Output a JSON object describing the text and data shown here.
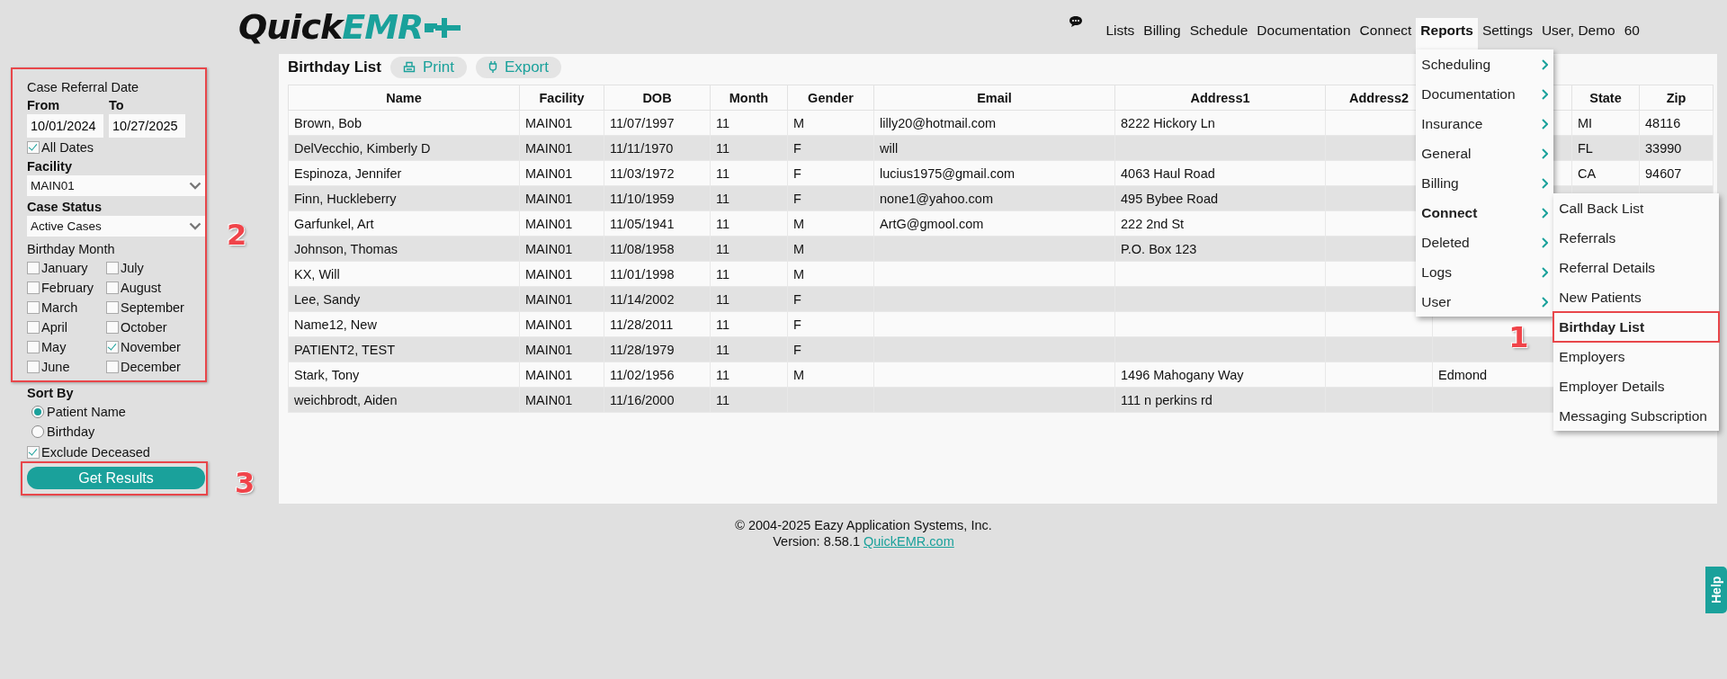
{
  "header": {
    "logo": {
      "part_1": "Quick",
      "part_2": "EMR"
    },
    "nav": [
      {
        "label": "Lists",
        "selected": false
      },
      {
        "label": "Billing",
        "selected": false
      },
      {
        "label": "Schedule",
        "selected": false
      },
      {
        "label": "Documentation",
        "selected": false
      },
      {
        "label": "Connect",
        "selected": false
      },
      {
        "label": "Reports",
        "selected": true
      },
      {
        "label": "Settings",
        "selected": false
      },
      {
        "label": "User, Demo",
        "selected": false
      },
      {
        "label": "60",
        "selected": false
      }
    ]
  },
  "reports_menu": {
    "items": [
      {
        "label": "Scheduling",
        "expanded": false
      },
      {
        "label": "Documentation",
        "expanded": false
      },
      {
        "label": "Insurance",
        "expanded": false
      },
      {
        "label": "General",
        "expanded": false
      },
      {
        "label": "Billing",
        "expanded": false
      },
      {
        "label": "Connect",
        "expanded": true
      },
      {
        "label": "Deleted",
        "expanded": false
      },
      {
        "label": "Logs",
        "expanded": false
      },
      {
        "label": "User",
        "expanded": false
      }
    ],
    "submenu": {
      "items": [
        {
          "label": "Call Back List",
          "selected": false
        },
        {
          "label": "Referrals",
          "selected": false
        },
        {
          "label": "Referral Details",
          "selected": false
        },
        {
          "label": "New Patients",
          "selected": false
        },
        {
          "label": "Birthday List",
          "selected": true,
          "callout": "1"
        },
        {
          "label": "Employers",
          "selected": false
        },
        {
          "label": "Employer Details",
          "selected": false
        },
        {
          "label": "Messaging Subscription",
          "selected": false
        }
      ]
    }
  },
  "filters": {
    "callout": "2",
    "title": "Case Referral Date",
    "from": {
      "label": "From",
      "value": "10/01/2024"
    },
    "to": {
      "label": "To",
      "value": "10/27/2025"
    },
    "all_dates": {
      "label": "All Dates",
      "checked": true
    },
    "facility": {
      "label": "Facility",
      "value": "MAIN01"
    },
    "case_status": {
      "label": "Case Status",
      "value": "Active Cases"
    },
    "birthday_month": {
      "label": "Birthday Month",
      "months": [
        {
          "label": "January",
          "checked": false
        },
        {
          "label": "February",
          "checked": false
        },
        {
          "label": "March",
          "checked": false
        },
        {
          "label": "April",
          "checked": false
        },
        {
          "label": "May",
          "checked": false
        },
        {
          "label": "June",
          "checked": false
        },
        {
          "label": "July",
          "checked": false
        },
        {
          "label": "August",
          "checked": false
        },
        {
          "label": "September",
          "checked": false
        },
        {
          "label": "October",
          "checked": false
        },
        {
          "label": "November",
          "checked": true
        },
        {
          "label": "December",
          "checked": false
        }
      ]
    }
  },
  "sort_by": {
    "label": "Sort By",
    "options": [
      {
        "label": "Patient Name",
        "selected": true
      },
      {
        "label": "Birthday",
        "selected": false
      }
    ]
  },
  "exclude_deceased": {
    "label": "Exclude Deceased",
    "checked": true
  },
  "get_results": {
    "label": "Get Results",
    "callout": "3"
  },
  "report": {
    "title": "Birthday List",
    "actions": [
      {
        "label": "Print",
        "kind": "print"
      },
      {
        "label": "Export",
        "kind": "export"
      }
    ],
    "table": {
      "columns": [
        "Name",
        "Facility",
        "DOB",
        "Month",
        "Gender",
        "Email",
        "Address1",
        "Address2",
        null,
        "State",
        "Zip"
      ],
      "rows": [
        [
          "Brown, Bob",
          "MAIN01",
          "11/07/1997",
          "11",
          "M",
          "lilly20@hotmail.com",
          "8222 Hickory Ln",
          null,
          null,
          "MI",
          "48116"
        ],
        [
          "DelVecchio, Kimberly D",
          "MAIN01",
          "11/11/1970",
          "11",
          "F",
          "will",
          null,
          null,
          null,
          "FL",
          "33990"
        ],
        [
          "Espinoza, Jennifer",
          "MAIN01",
          "11/03/1972",
          "11",
          "F",
          "lucius1975@gmail.com",
          "4063 Haul Road",
          null,
          null,
          "CA",
          "94607"
        ],
        [
          "Finn, Huckleberry",
          "MAIN01",
          "11/10/1959",
          "11",
          "F",
          "none1@yahoo.com",
          "495 Bybee Road"
        ],
        [
          "Garfunkel, Art",
          "MAIN01",
          "11/05/1941",
          "11",
          "M",
          "ArtG@gmool.com",
          "222 2nd St"
        ],
        [
          "Johnson, Thomas",
          "MAIN01",
          "11/08/1958",
          "11",
          "M",
          null,
          "P.O. Box 123"
        ],
        [
          "KX, Will",
          "MAIN01",
          "11/01/1998",
          "11",
          "M"
        ],
        [
          "Lee, Sandy",
          "MAIN01",
          "11/14/2002",
          "11",
          "F"
        ],
        [
          "Name12, New",
          "MAIN01",
          "11/28/2011",
          "11",
          "F"
        ],
        [
          "PATIENT2, TEST",
          "MAIN01",
          "11/28/1979",
          "11",
          "F"
        ],
        [
          "Stark, Tony",
          "MAIN01",
          "11/02/1956",
          "11",
          "M",
          null,
          "1496 Mahogany Way",
          null,
          "Edmond"
        ],
        [
          "weichbrodt, Aiden",
          "MAIN01",
          "11/16/2000",
          "11",
          null,
          null,
          "111 n perkins rd"
        ]
      ]
    }
  },
  "footer": {
    "copyright": "© 2004-2025 Eazy Application Systems, Inc.",
    "version": "Version: 8.58.1",
    "link": "QuickEMR.com"
  },
  "help_tab": {
    "label": "Help"
  }
}
